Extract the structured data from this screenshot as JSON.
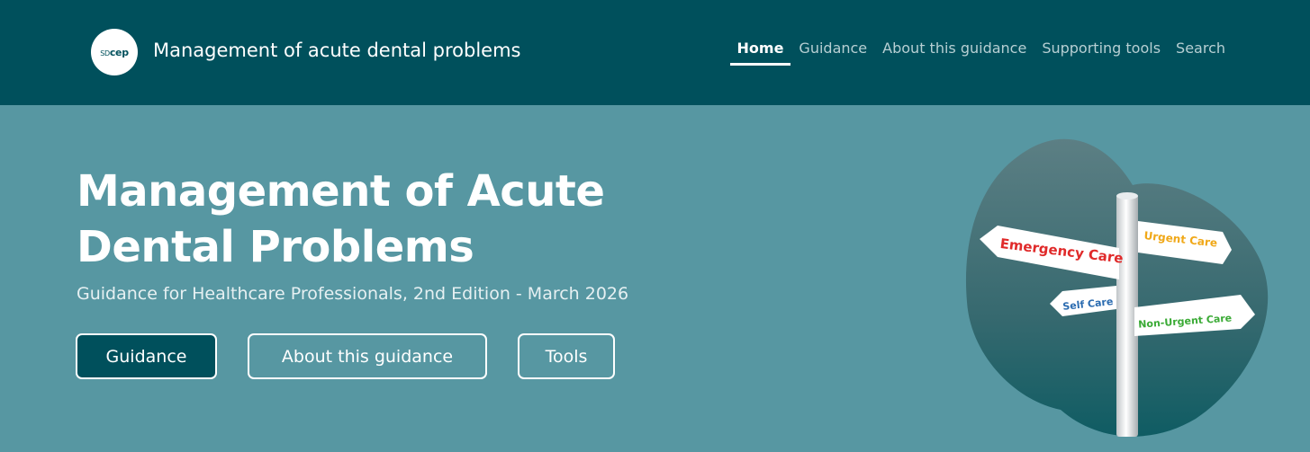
{
  "header": {
    "logo_text": "cep",
    "logo_prefix": "SD",
    "site_title": "Management of acute dental problems",
    "nav": [
      {
        "label": "Home",
        "active": true
      },
      {
        "label": "Guidance",
        "active": false
      },
      {
        "label": "About this guidance",
        "active": false
      },
      {
        "label": "Supporting tools",
        "active": false
      },
      {
        "label": "Search",
        "active": false
      }
    ]
  },
  "hero": {
    "title": "Management of Acute Dental Problems",
    "subtitle": "Guidance for Healthcare Professionals, 2nd Edition - March 2026",
    "buttons": {
      "guidance": "Guidance",
      "about": "About this guidance",
      "tools": "Tools"
    },
    "signpost": {
      "emergency": "Emergency Care",
      "urgent": "Urgent Care",
      "self": "Self Care",
      "non_urgent": "Non-Urgent Care"
    }
  },
  "colors": {
    "header_bg": "#00505c",
    "hero_bg": "#5797a2",
    "emergency": "#e02a2a",
    "urgent": "#f0a818",
    "self": "#2a6bb0",
    "non_urgent": "#3aaa35"
  }
}
